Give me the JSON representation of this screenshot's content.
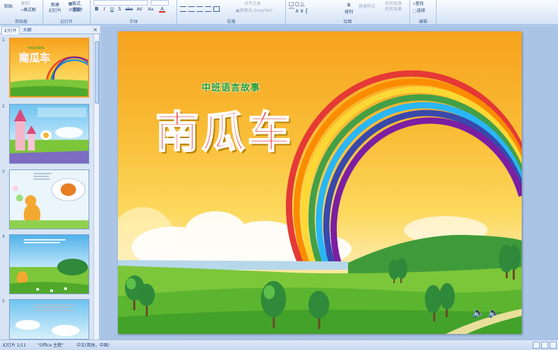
{
  "ribbon": {
    "clipboard": {
      "paste": "粘贴",
      "copy": "复制",
      "format_painter": "格式刷",
      "group": "剪贴板"
    },
    "slides": {
      "new_slide": "新建",
      "new_slide2": "幻灯片",
      "layout": "版式",
      "reset": "重设",
      "delete": "删除",
      "group": "幻灯片"
    },
    "font": {
      "bold": "B",
      "italic": "I",
      "underline": "U",
      "shadow": "S",
      "strike": "abe",
      "spacing": "AV",
      "case": "Aa",
      "color": "A",
      "group": "字体"
    },
    "paragraph": {
      "smartart": "转换为 SmartArt",
      "align_text": "对齐文本",
      "group": "段落"
    },
    "drawing": {
      "arrange": "排列",
      "quick_styles": "快速样式",
      "shape_effects": "形状效果",
      "group": "绘图",
      "shape_outline": "形状轮廓"
    },
    "editing": {
      "find": "查找",
      "replace": "替换",
      "select": "选择",
      "group": "编辑"
    }
  },
  "panel": {
    "tab_slides": "幻灯片",
    "tab_outline": "大纲",
    "close": "×",
    "slides": [
      {
        "num": "1"
      },
      {
        "num": "2"
      },
      {
        "num": "3"
      },
      {
        "num": "4"
      },
      {
        "num": "5"
      }
    ]
  },
  "slide": {
    "subtitle": "中班语言故事",
    "title": "南瓜车"
  },
  "thumb1": {
    "subtitle": "中班语言故事",
    "title": "南瓜车"
  },
  "status": {
    "slide_pos": "幻灯片 1/11",
    "theme": "\"Office 主题\"",
    "lang": "中文(简体，中国)"
  },
  "colors": {
    "ribbon_bg": "#dfe9f7",
    "title_red": "#e8161b",
    "subtitle_green": "#1e9a2a",
    "selected_border": "#f0a030"
  }
}
